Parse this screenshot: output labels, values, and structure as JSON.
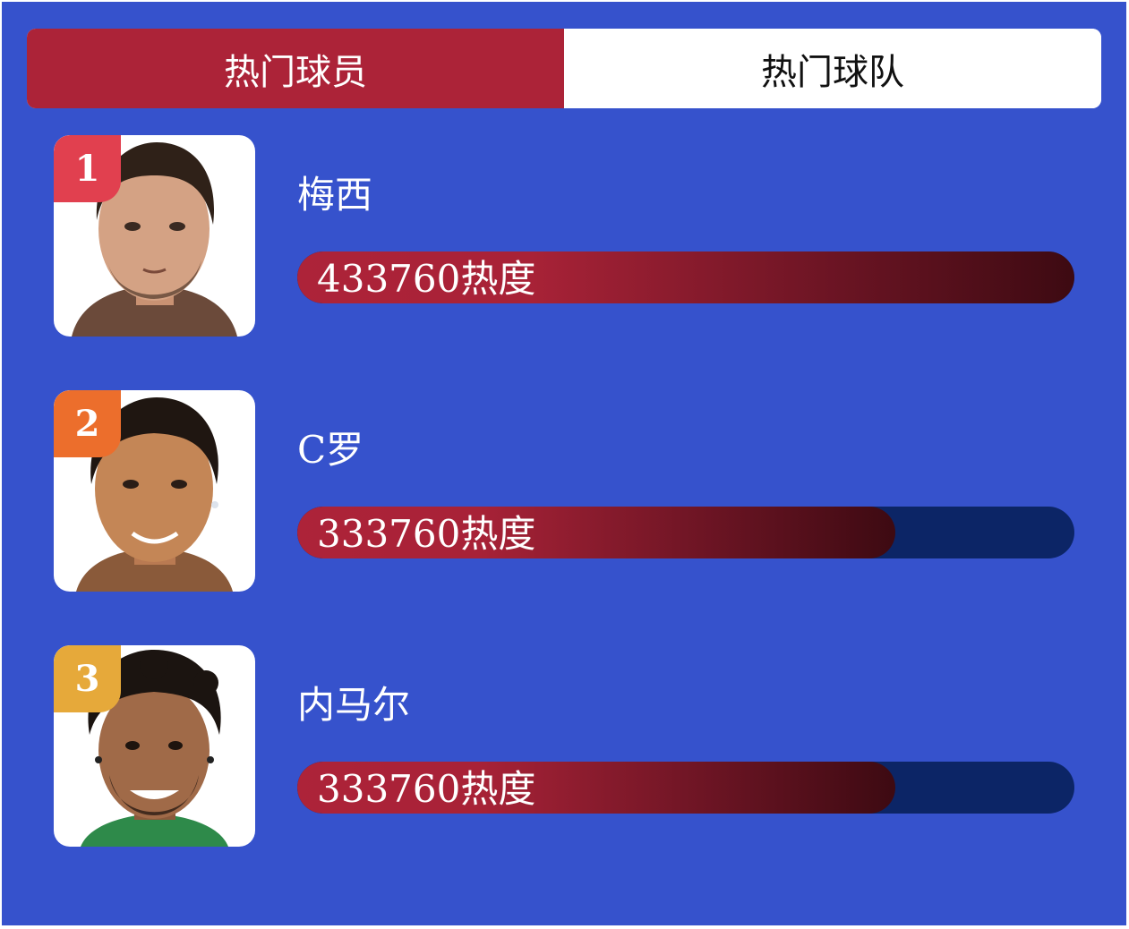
{
  "tabs": [
    {
      "label": "热门球员",
      "active": true
    },
    {
      "label": "热门球队",
      "active": false
    }
  ],
  "colors": {
    "background": "#3652cc",
    "active_tab": "#ac2338",
    "bar_track": "#0c2566",
    "bar_start": "#ad2339",
    "bar_end": "#3d0a12",
    "rank_1": "#e1404f",
    "rank_2": "#ec6e2c",
    "rank_3": "#e6a93a"
  },
  "players": [
    {
      "rank": "1",
      "name": "梅西",
      "heat_label": "433760热度",
      "heat_value": 433760,
      "fill_fraction": 1.0,
      "avatar_icon": "player-photo-icon"
    },
    {
      "rank": "2",
      "name": "C罗",
      "heat_label": "333760热度",
      "heat_value": 333760,
      "fill_fraction": 0.77,
      "avatar_icon": "player-photo-icon"
    },
    {
      "rank": "3",
      "name": "内马尔",
      "heat_label": "333760热度",
      "heat_value": 333760,
      "fill_fraction": 0.77,
      "avatar_icon": "player-photo-icon"
    }
  ]
}
